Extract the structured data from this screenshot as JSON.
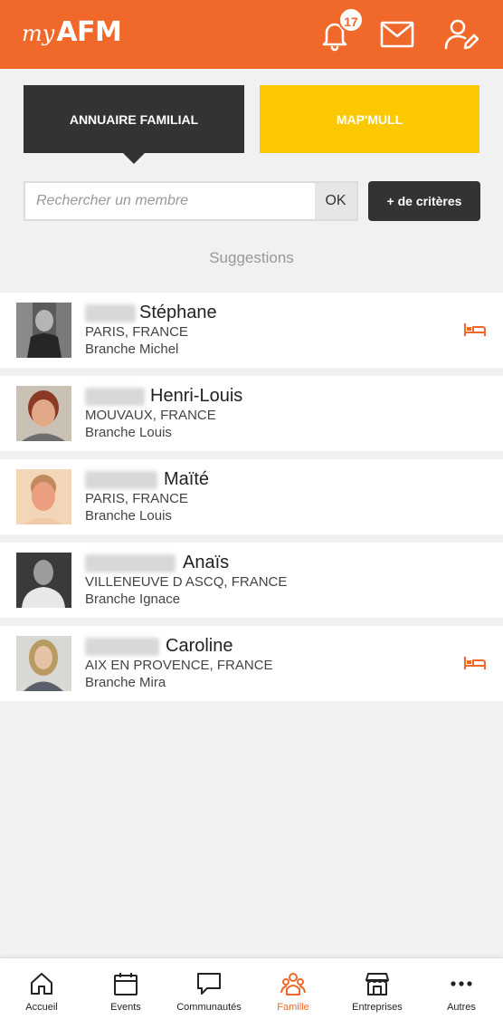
{
  "header": {
    "logo_my": "my",
    "logo_afm": "AFM",
    "notification_count": "17",
    "icons": [
      "bell-icon",
      "mail-icon",
      "user-edit-icon"
    ]
  },
  "tabs": [
    {
      "label": "ANNUAIRE FAMILIAL",
      "active": true
    },
    {
      "label": "MAP'MULL",
      "active": false
    }
  ],
  "search": {
    "placeholder": "Rechercher un membre",
    "value": "",
    "ok_label": "OK",
    "criteria_label": "+ de critères"
  },
  "suggestions_title": "Suggestions",
  "members": [
    {
      "first_name": "Stéphane",
      "city": "PARIS, FRANCE",
      "branch": "Branche Michel",
      "bed_icon": true
    },
    {
      "first_name": "Henri-Louis",
      "city": "MOUVAUX, FRANCE",
      "branch": "Branche Louis",
      "bed_icon": false
    },
    {
      "first_name": "Maïté",
      "city": "PARIS, FRANCE",
      "branch": "Branche Louis",
      "bed_icon": false
    },
    {
      "first_name": "Anaïs",
      "city": "VILLENEUVE D ASCQ, FRANCE",
      "branch": "Branche Ignace",
      "bed_icon": false
    },
    {
      "first_name": "Caroline",
      "city": "AIX EN PROVENCE, FRANCE",
      "branch": "Branche Mira",
      "bed_icon": true
    }
  ],
  "nav": [
    {
      "label": "Accueil",
      "icon": "home-icon",
      "active": false
    },
    {
      "label": "Events",
      "icon": "calendar-icon",
      "active": false
    },
    {
      "label": "Communautés",
      "icon": "chat-icon",
      "active": false
    },
    {
      "label": "Famille",
      "icon": "family-icon",
      "active": true
    },
    {
      "label": "Entreprises",
      "icon": "store-icon",
      "active": false
    },
    {
      "label": "Autres",
      "icon": "more-icon",
      "active": false
    }
  ],
  "colors": {
    "brand": "#f0682a",
    "dark": "#333333",
    "yellow": "#fcc800"
  }
}
